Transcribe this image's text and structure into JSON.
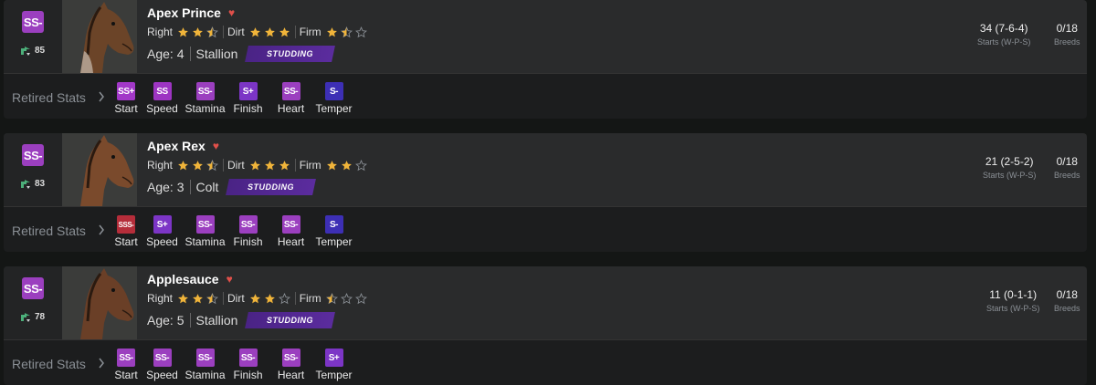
{
  "colors": {
    "grade_ss_plus": "#a238c8",
    "grade_ss": "#9d35c2",
    "grade_ss_minus": "#9b3fbf",
    "grade_s_plus": "#7c35c6",
    "grade_s": "#5b37c8",
    "grade_s_minus": "#3d2fb5",
    "grade_sss_minus": "#b52d3a",
    "star": "#f0b43a",
    "heart": "#e0504a",
    "status_tag": "#4a2385"
  },
  "labels": {
    "retired_stats": "Retired Stats",
    "starts_caption": "Starts (W-P-S)",
    "breeds_caption": "Breeds",
    "age_prefix": "Age:"
  },
  "horses": [
    {
      "name": "Apex Prince",
      "grade": "SS-",
      "rating": "85",
      "favorite": true,
      "prefs": [
        {
          "label": "Right",
          "stars": 2.5
        },
        {
          "label": "Dirt",
          "stars": 3
        },
        {
          "label": "Firm",
          "stars": 1.5
        }
      ],
      "age": "4",
      "gender": "Stallion",
      "status": "STUDDING",
      "record": "34 (7-6-4)",
      "breeds": "0/18",
      "stats": [
        {
          "label": "Start",
          "grade": "SS+"
        },
        {
          "label": "Speed",
          "grade": "SS"
        },
        {
          "label": "Stamina",
          "grade": "SS-"
        },
        {
          "label": "Finish",
          "grade": "S+"
        },
        {
          "label": "Heart",
          "grade": "SS-"
        },
        {
          "label": "Temper",
          "grade": "S-"
        }
      ]
    },
    {
      "name": "Apex Rex",
      "grade": "SS-",
      "rating": "83",
      "favorite": true,
      "prefs": [
        {
          "label": "Right",
          "stars": 2.5
        },
        {
          "label": "Dirt",
          "stars": 3
        },
        {
          "label": "Firm",
          "stars": 2
        }
      ],
      "age": "3",
      "gender": "Colt",
      "status": "STUDDING",
      "record": "21 (2-5-2)",
      "breeds": "0/18",
      "stats": [
        {
          "label": "Start",
          "grade": "SSS-"
        },
        {
          "label": "Speed",
          "grade": "S+"
        },
        {
          "label": "Stamina",
          "grade": "SS-"
        },
        {
          "label": "Finish",
          "grade": "SS-"
        },
        {
          "label": "Heart",
          "grade": "SS-"
        },
        {
          "label": "Temper",
          "grade": "S-"
        }
      ]
    },
    {
      "name": "Applesauce",
      "grade": "SS-",
      "rating": "78",
      "favorite": true,
      "prefs": [
        {
          "label": "Right",
          "stars": 2.5
        },
        {
          "label": "Dirt",
          "stars": 2
        },
        {
          "label": "Firm",
          "stars": 0.5
        }
      ],
      "age": "5",
      "gender": "Stallion",
      "status": "STUDDING",
      "record": "11 (0-1-1)",
      "breeds": "0/18",
      "stats": [
        {
          "label": "Start",
          "grade": "SS-"
        },
        {
          "label": "Speed",
          "grade": "SS-"
        },
        {
          "label": "Stamina",
          "grade": "SS-"
        },
        {
          "label": "Finish",
          "grade": "SS-"
        },
        {
          "label": "Heart",
          "grade": "SS-"
        },
        {
          "label": "Temper",
          "grade": "S+"
        }
      ]
    }
  ]
}
